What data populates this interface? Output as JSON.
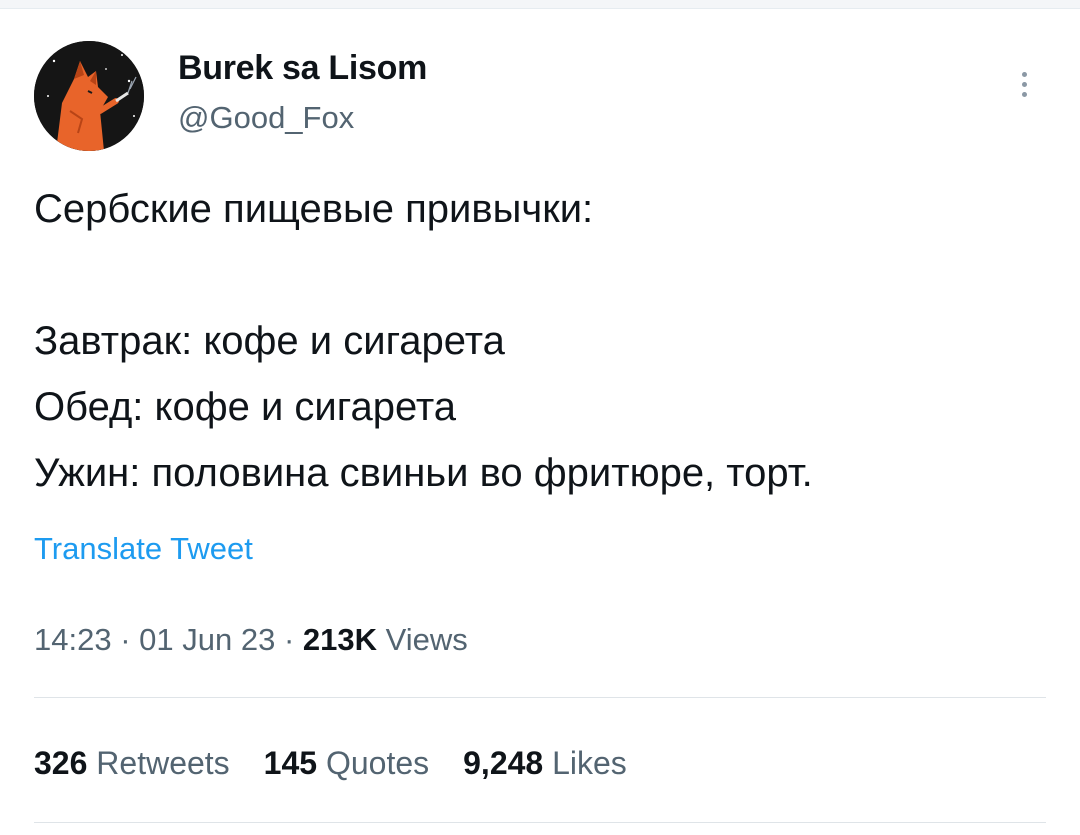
{
  "tweet": {
    "author": {
      "display_name": "Burek sa Lisom",
      "handle": "@Good_Fox",
      "avatar_icon": "fox-avatar"
    },
    "text_lines": [
      "Сербские пищевые привычки:",
      "",
      "Завтрак: кофе и сигарета",
      "Обед: кофе и сигарета",
      "Ужин: половина свиньи во фритюре, торт."
    ],
    "translate_label": "Translate Tweet",
    "time": "14:23",
    "date": "01 Jun 23",
    "separator": "·",
    "views_count": "213K",
    "views_label": "Views",
    "stats": {
      "retweets_count": "326",
      "retweets_label": "Retweets",
      "quotes_count": "145",
      "quotes_label": "Quotes",
      "likes_count": "9,248",
      "likes_label": "Likes"
    },
    "more_icon": "more-vertical-icon"
  },
  "colors": {
    "text": "#0f1419",
    "secondary": "#536471",
    "link": "#1d9bf0",
    "divider": "#dfe4e8"
  }
}
